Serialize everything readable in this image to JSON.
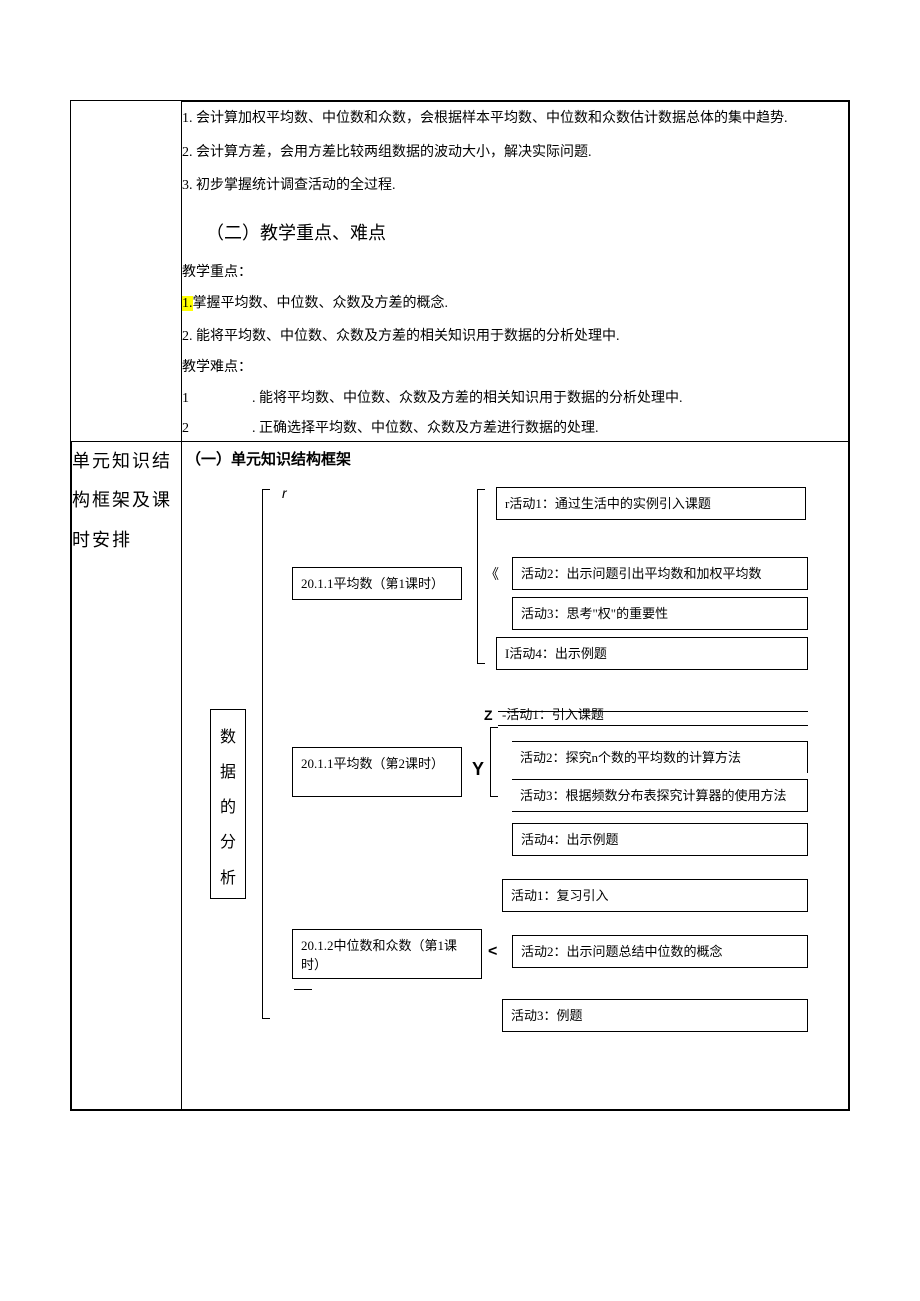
{
  "row1": {
    "p1": "1. 会计算加权平均数、中位数和众数，会根据样本平均数、中位数和众数估计数据总体的集中趋势.",
    "p2": "2. 会计算方差，会用方差比较两组数据的波动大小，解决实际问题.",
    "p3": "3. 初步掌握统计调查活动的全过程.",
    "h2": "（二）教学重点、难点",
    "focus_label": "教学重点：",
    "focus_1_num": "1.",
    "focus_1_text": "掌握平均数、中位数、众数及方差的概念.",
    "focus_2": "2. 能将平均数、中位数、众数及方差的相关知识用于数据的分析处理中.",
    "diff_label": "教学难点：",
    "diff_1_num": "1",
    "diff_1_text": ". 能将平均数、中位数、众数及方差的相关知识用于数据的分析处理中.",
    "diff_2_num": "2",
    "diff_2_text": ". 正确选择平均数、中位数、众数及方差进行数据的处理."
  },
  "row2": {
    "left": "单元知识结构框架及课时安排",
    "title": "（一）单元知识结构框架",
    "root": "数据的分析",
    "r_glyph": "r",
    "y_glyph": "Y",
    "lt_glyph": "<",
    "z_glyph": "Z",
    "open_quote": "《",
    "lesson1": {
      "title": "20.1.1平均数（第1课时）",
      "a1_prefix": "r",
      "a1": "活动1：通过生活中的实例引入课题",
      "a2": "活动2：出示问题引出平均数和加权平均数",
      "a3": "活动3：思考\"权\"的重要性",
      "a4_prefix": "I",
      "a4": "活动4：出示例题"
    },
    "lesson2": {
      "title": "20.1.1平均数（第2课时）",
      "a1": "-活动1：引入课题",
      "a2": "活动2：探究n个数的平均数的计算方法",
      "a3": "活动3：根据频数分布表探究计算器的使用方法",
      "a4": "活动4：出示例题"
    },
    "lesson3": {
      "title": "20.1.2中位数和众数（第1课时）",
      "a1": "活动1：复习引入",
      "a2": "活动2：出示问题总结中位数的概念",
      "a3": "活动3：例题"
    }
  }
}
